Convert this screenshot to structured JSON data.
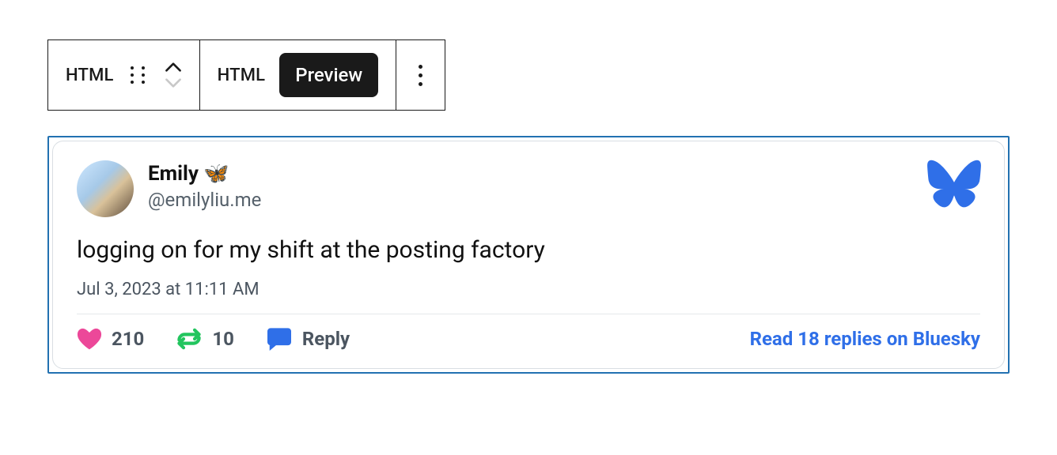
{
  "toolbar": {
    "block_type_label": "HTML",
    "tabs": {
      "html": "HTML",
      "preview": "Preview"
    }
  },
  "post": {
    "display_name": "Emily",
    "display_name_emoji": "🦋",
    "handle": "@emilyliu.me",
    "text": "logging on for my shift at the posting factory",
    "timestamp": "Jul 3, 2023 at 11:11 AM",
    "likes": "210",
    "reposts": "10",
    "reply_label": "Reply",
    "read_replies_label": "Read 18 replies on Bluesky"
  }
}
